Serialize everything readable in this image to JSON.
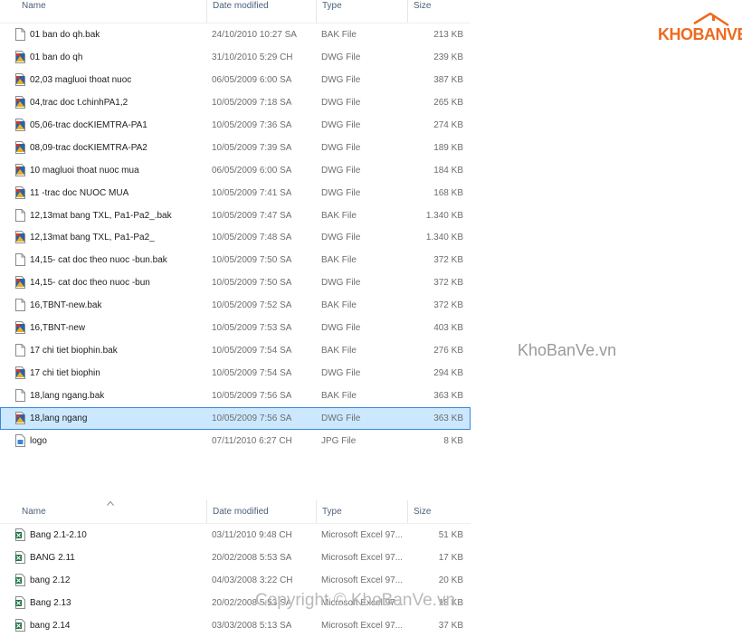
{
  "pane1": {
    "headers": {
      "name": "Name",
      "date": "Date modified",
      "type": "Type",
      "size": "Size"
    },
    "rows": [
      {
        "name": "01 ban do qh.bak",
        "date": "24/10/2010 10:27 SA",
        "type": "BAK File",
        "size": "213 KB",
        "icon": "bak"
      },
      {
        "name": "01 ban do qh",
        "date": "31/10/2010 5:29 CH",
        "type": "DWG File",
        "size": "239 KB",
        "icon": "dwg"
      },
      {
        "name": "02,03 magluoi thoat nuoc",
        "date": "06/05/2009 6:00 SA",
        "type": "DWG File",
        "size": "387 KB",
        "icon": "dwg"
      },
      {
        "name": "04,trac doc t.chinhPA1,2",
        "date": "10/05/2009 7:18 SA",
        "type": "DWG File",
        "size": "265 KB",
        "icon": "dwg"
      },
      {
        "name": "05,06-trac docKIEMTRA-PA1",
        "date": "10/05/2009 7:36 SA",
        "type": "DWG File",
        "size": "274 KB",
        "icon": "dwg"
      },
      {
        "name": "08,09-trac docKIEMTRA-PA2",
        "date": "10/05/2009 7:39 SA",
        "type": "DWG File",
        "size": "189 KB",
        "icon": "dwg"
      },
      {
        "name": "10 magluoi thoat nuoc mua",
        "date": "06/05/2009 6:00 SA",
        "type": "DWG File",
        "size": "184 KB",
        "icon": "dwg"
      },
      {
        "name": "11 -trac doc NUOC MUA",
        "date": "10/05/2009 7:41 SA",
        "type": "DWG File",
        "size": "168 KB",
        "icon": "dwg"
      },
      {
        "name": "12,13mat bang TXL, Pa1-Pa2_.bak",
        "date": "10/05/2009 7:47 SA",
        "type": "BAK File",
        "size": "1.340 KB",
        "icon": "bak"
      },
      {
        "name": "12,13mat bang TXL, Pa1-Pa2_",
        "date": "10/05/2009 7:48 SA",
        "type": "DWG File",
        "size": "1.340 KB",
        "icon": "dwg"
      },
      {
        "name": "14,15- cat doc theo nuoc -bun.bak",
        "date": "10/05/2009 7:50 SA",
        "type": "BAK File",
        "size": "372 KB",
        "icon": "bak"
      },
      {
        "name": "14,15- cat doc theo nuoc -bun",
        "date": "10/05/2009 7:50 SA",
        "type": "DWG File",
        "size": "372 KB",
        "icon": "dwg"
      },
      {
        "name": "16,TBNT-new.bak",
        "date": "10/05/2009 7:52 SA",
        "type": "BAK File",
        "size": "372 KB",
        "icon": "bak"
      },
      {
        "name": "16,TBNT-new",
        "date": "10/05/2009 7:53 SA",
        "type": "DWG File",
        "size": "403 KB",
        "icon": "dwg"
      },
      {
        "name": "17 chi tiet biophin.bak",
        "date": "10/05/2009 7:54 SA",
        "type": "BAK File",
        "size": "276 KB",
        "icon": "bak"
      },
      {
        "name": "17 chi tiet biophin",
        "date": "10/05/2009 7:54 SA",
        "type": "DWG File",
        "size": "294 KB",
        "icon": "dwg"
      },
      {
        "name": "18,lang ngang.bak",
        "date": "10/05/2009 7:56 SA",
        "type": "BAK File",
        "size": "363 KB",
        "icon": "bak"
      },
      {
        "name": "18,lang ngang",
        "date": "10/05/2009 7:56 SA",
        "type": "DWG File",
        "size": "363 KB",
        "icon": "dwg",
        "selected": true
      },
      {
        "name": "logo",
        "date": "07/11/2010 6:27 CH",
        "type": "JPG File",
        "size": "8 KB",
        "icon": "jpg"
      }
    ]
  },
  "pane2": {
    "headers": {
      "name": "Name",
      "date": "Date modified",
      "type": "Type",
      "size": "Size"
    },
    "rows": [
      {
        "name": "Bang 2.1-2.10",
        "date": "03/11/2010 9:48 CH",
        "type": "Microsoft Excel 97...",
        "size": "51 KB",
        "icon": "xls"
      },
      {
        "name": "BANG 2.11",
        "date": "20/02/2008 5:53 SA",
        "type": "Microsoft Excel 97...",
        "size": "17 KB",
        "icon": "xls"
      },
      {
        "name": "bang 2.12",
        "date": "04/03/2008 3:22 CH",
        "type": "Microsoft Excel 97...",
        "size": "20 KB",
        "icon": "xls"
      },
      {
        "name": "Bang 2.13",
        "date": "20/02/2008 5:53 SA",
        "type": "Microsoft Excel 97...",
        "size": "18 KB",
        "icon": "xls"
      },
      {
        "name": "bang 2.14",
        "date": "03/03/2008 5:13 SA",
        "type": "Microsoft Excel 97...",
        "size": "37 KB",
        "icon": "xls"
      }
    ]
  },
  "logo_text": "KHOBANVE",
  "watermark": "KhoBanVe.vn",
  "copyright": "Copyright © KhoBanVe.vn",
  "colors": {
    "accent": "#ee6a1f",
    "selection": "#cce8ff",
    "selection_border": "#3c86d8"
  }
}
